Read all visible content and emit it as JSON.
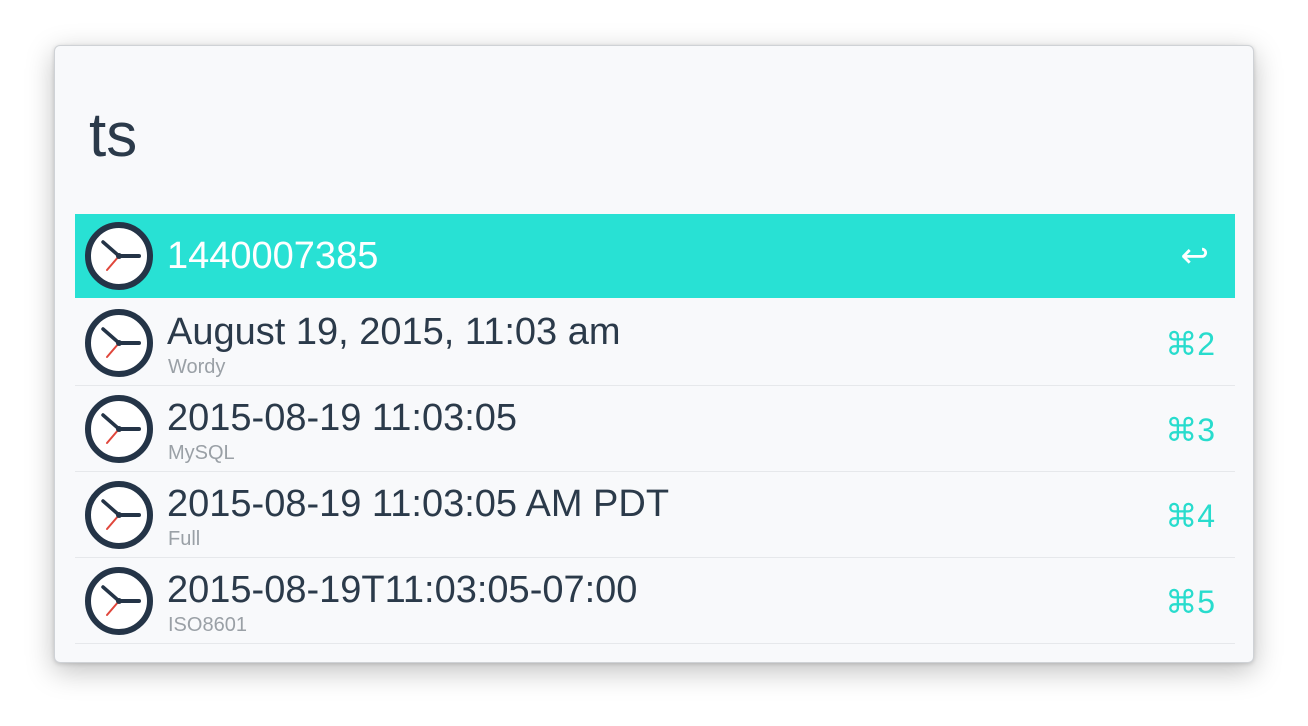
{
  "search": {
    "query": "ts"
  },
  "results": [
    {
      "title": "1440007385",
      "subtitle": "",
      "shortcut": "↩",
      "selected": true,
      "icon": "clock-icon"
    },
    {
      "title": "August 19, 2015, 11:03 am",
      "subtitle": "Wordy",
      "shortcut": "⌘2",
      "selected": false,
      "icon": "clock-icon"
    },
    {
      "title": "2015-08-19 11:03:05",
      "subtitle": "MySQL",
      "shortcut": "⌘3",
      "selected": false,
      "icon": "clock-icon"
    },
    {
      "title": "2015-08-19 11:03:05 AM PDT",
      "subtitle": "Full",
      "shortcut": "⌘4",
      "selected": false,
      "icon": "clock-icon"
    },
    {
      "title": "2015-08-19T11:03:05-07:00",
      "subtitle": "ISO8601",
      "shortcut": "⌘5",
      "selected": false,
      "icon": "clock-icon"
    }
  ],
  "colors": {
    "accent": "#28e1d4",
    "text": "#2b3a4a",
    "subtext": "#9aa0a6",
    "clock_face": "#243447",
    "clock_hand_red": "#e0463b"
  }
}
